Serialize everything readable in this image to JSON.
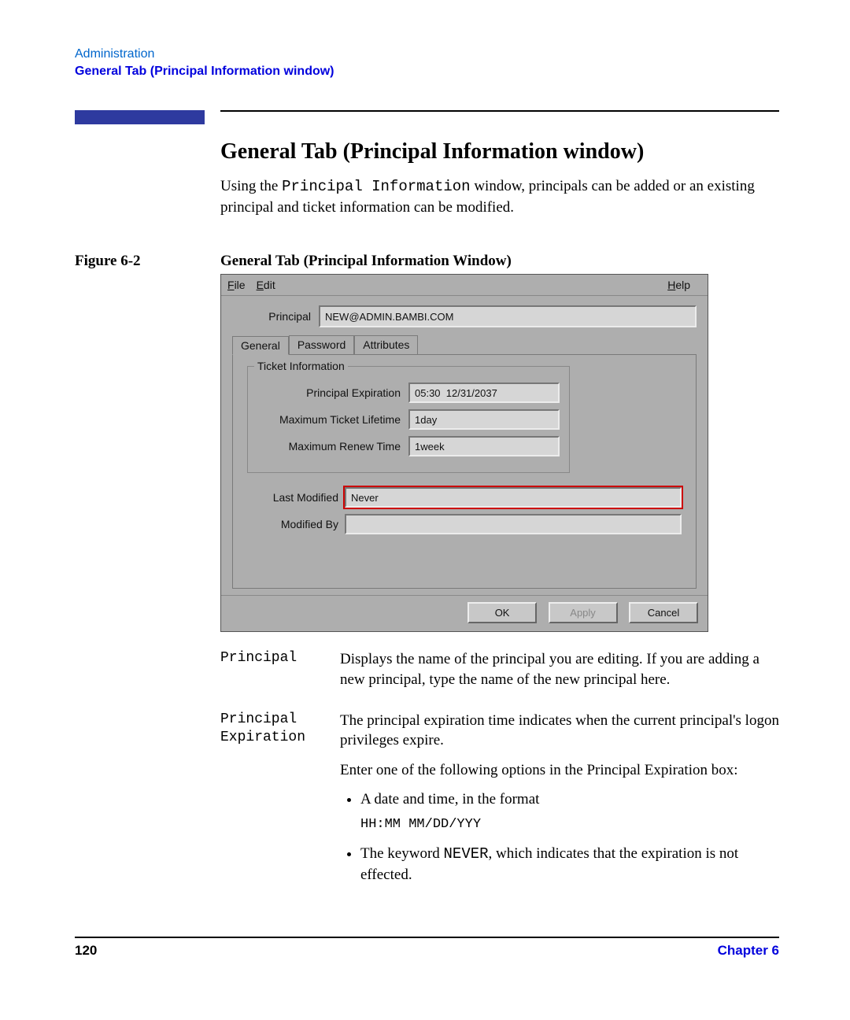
{
  "header": {
    "admin": "Administration",
    "subtitle": "General Tab (Principal Information window)"
  },
  "section_title": "General Tab (Principal Information window)",
  "intro_prefix": "Using the ",
  "intro_mono": "Principal Information",
  "intro_suffix": " window, principals can be added or an existing principal and ticket information can be modified.",
  "figure": {
    "label": "Figure 6-2",
    "caption": "General Tab (Principal Information Window)"
  },
  "gui": {
    "menu": {
      "file": "File",
      "edit": "Edit",
      "help": "Help"
    },
    "principal_label": "Principal",
    "principal_value": "NEW@ADMIN.BAMBI.COM",
    "tabs": {
      "general": "General",
      "password": "Password",
      "attributes": "Attributes"
    },
    "ticket_legend": "Ticket Information",
    "fields": {
      "exp_label": "Principal Expiration",
      "exp_value": "05:30  12/31/2037",
      "life_label": "Maximum Ticket Lifetime",
      "life_value": "1day",
      "renew_label": "Maximum Renew Time",
      "renew_value": "1week"
    },
    "last_modified_label": "Last Modified",
    "last_modified_value": "Never",
    "modified_by_label": "Modified By",
    "modified_by_value": "",
    "buttons": {
      "ok": "OK",
      "apply": "Apply",
      "cancel": "Cancel"
    }
  },
  "defs": [
    {
      "term": "Principal",
      "desc_html": "Displays the name of the principal you are editing. If you are adding a new principal, type the name of the new principal here."
    }
  ],
  "def2": {
    "term": "Principal Expiration",
    "p1": "The principal expiration time indicates when the current principal's logon privileges expire.",
    "p2": "Enter one of the following options in the Principal Expiration box:",
    "li1": "A date and time, in the format",
    "li1_mono": "HH:MM MM/DD/YYY",
    "li2_pre": "The keyword ",
    "li2_mono": "NEVER",
    "li2_post": ", which indicates that the expiration is not effected."
  },
  "footer": {
    "page": "120",
    "chapter": "Chapter 6"
  }
}
